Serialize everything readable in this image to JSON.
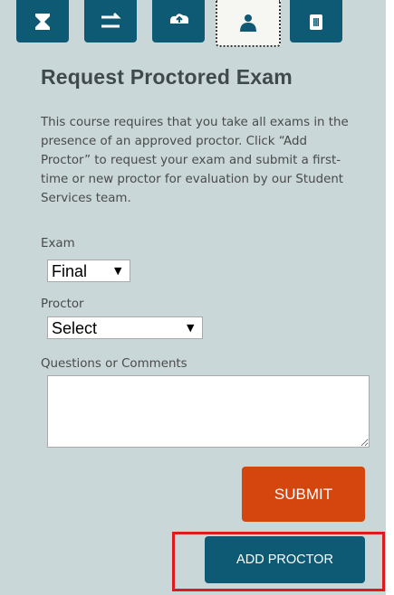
{
  "toolbar": {
    "tools": [
      {
        "icon": "hourglass-icon"
      },
      {
        "icon": "swap-arrows-icon"
      },
      {
        "icon": "cloud-upload-icon"
      },
      {
        "icon": "user-icon",
        "active": true
      },
      {
        "icon": "trash-icon"
      }
    ]
  },
  "page": {
    "title": "Request Proctored Exam",
    "description": "This course requires that you take all exams in the presence of an approved proctor. Click “Add Proctor” to request your exam and submit a first-time or new proctor for evaluation by our Student Services team."
  },
  "form": {
    "exam_label": "Exam",
    "exam_value": "Final",
    "proctor_label": "Proctor",
    "proctor_value": "Select",
    "comments_label": "Questions or Comments",
    "comments_value": "",
    "submit_label": "SUBMIT",
    "add_proctor_label": "ADD PROCTOR"
  },
  "colors": {
    "panel_bg": "#c9d7d8",
    "primary": "#0e5a74",
    "submit": "#d5460e",
    "highlight": "#e0191e"
  }
}
